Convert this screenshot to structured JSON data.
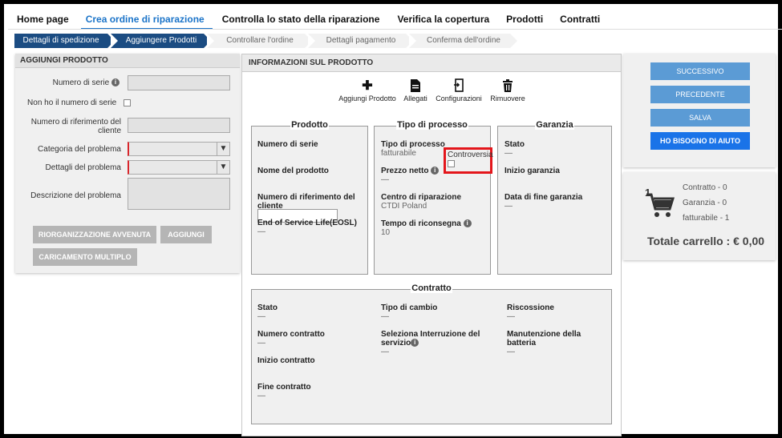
{
  "nav": {
    "items": [
      "Home page",
      "Crea ordine di riparazione",
      "Controlla lo stato della riparazione",
      "Verifica la copertura",
      "Prodotti",
      "Contratti"
    ]
  },
  "steps": [
    "Dettagli di spedizione",
    "Aggiungere Prodotti",
    "Controllare l'ordine",
    "Dettagli pagamento",
    "Conferma dell'ordine"
  ],
  "left": {
    "title": "AGGIUNGI PRODOTTO",
    "serial_label": "Numero di serie",
    "no_serial_label": "Non ho il numero di serie",
    "customer_ref_label": "Numero di riferimento del cliente",
    "problem_category_label": "Categoria del problema",
    "problem_details_label": "Dettagli del problema",
    "problem_description_label": "Descrizione del problema",
    "btn_reorg": "RIORGANIZZAZIONE AVVENUTA",
    "btn_add": "AGGIUNGI",
    "btn_bulk": "CARICAMENTO MULTIPLO"
  },
  "mid": {
    "title": "INFORMAZIONI SUL PRODOTTO",
    "tools": [
      "Aggiungi Prodotto",
      "Allegati",
      "Configurazioni",
      "Rimuovere"
    ],
    "prodotto": {
      "title": "Prodotto",
      "serial": "Numero di serie",
      "name": "Nome del prodotto",
      "custref": "Numero di riferimento del cliente",
      "eosl": "End of Service Life(EOSL)",
      "eosl_val": "—"
    },
    "processo": {
      "title": "Tipo di processo",
      "type_label": "Tipo di processo",
      "type_val": "fatturabile",
      "dispute": "Controversia",
      "price_label": "Prezzo netto",
      "price_val": "—",
      "center_label": "Centro di riparazione",
      "center_val": "CTDI Poland",
      "turn_label": "Tempo di riconsegna",
      "turn_val": "10"
    },
    "garanzia": {
      "title": "Garanzia",
      "state": "Stato",
      "state_val": "—",
      "start": "Inizio garanzia",
      "end": "Data di fine garanzia",
      "end_val": "—"
    },
    "contratto": {
      "title": "Contratto",
      "stato": "Stato",
      "stato_val": "—",
      "cambio": "Tipo di cambio",
      "cambio_val": "—",
      "risc": "Riscossione",
      "risc_val": "—",
      "num": "Numero contratto",
      "num_val": "—",
      "interr": "Seleziona Interruzione del servizio",
      "interr_val": "—",
      "batt": "Manutenzione della batteria",
      "batt_val": "—",
      "inizio": "Inizio contratto",
      "fine": "Fine contratto",
      "fine_val": "—"
    }
  },
  "right": {
    "next": "SUCCESSIVO",
    "prev": "PRECEDENTE",
    "save": "SALVA",
    "help": "HO BISOGNO DI AIUTO"
  },
  "cart": {
    "count": "1",
    "contract": "Contratto - 0",
    "warranty": "Garanzia - 0",
    "billable": "fatturabile - 1",
    "total": "Totale carrello : € 0,00"
  }
}
